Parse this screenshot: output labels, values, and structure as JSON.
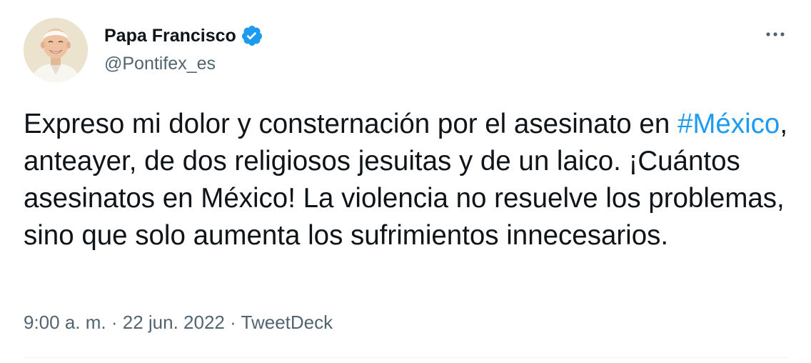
{
  "author": {
    "display_name": "Papa Francisco",
    "handle": "@Pontifex_es",
    "verified": true
  },
  "tweet": {
    "text_before": "Expreso mi dolor y consternación por el asesinato en ",
    "hashtag": "#México",
    "text_after": ", anteayer, de dos religiosos jesuitas y de un laico. ¡Cuántos asesinatos en México! La violencia no resuelve los problemas, sino que solo aumenta los sufrimientos innecesarios."
  },
  "meta": {
    "time": "9:00 a. m.",
    "separator1": " · ",
    "date": "22 jun. 2022",
    "separator2": " · ",
    "source": "TweetDeck"
  },
  "colors": {
    "link": "#1d9bf0",
    "text": "#0f1419",
    "secondary": "#536471",
    "verified": "#1d9bf0"
  },
  "icons": {
    "verified": "verified-badge-icon",
    "more": "more-horizontal-icon"
  }
}
